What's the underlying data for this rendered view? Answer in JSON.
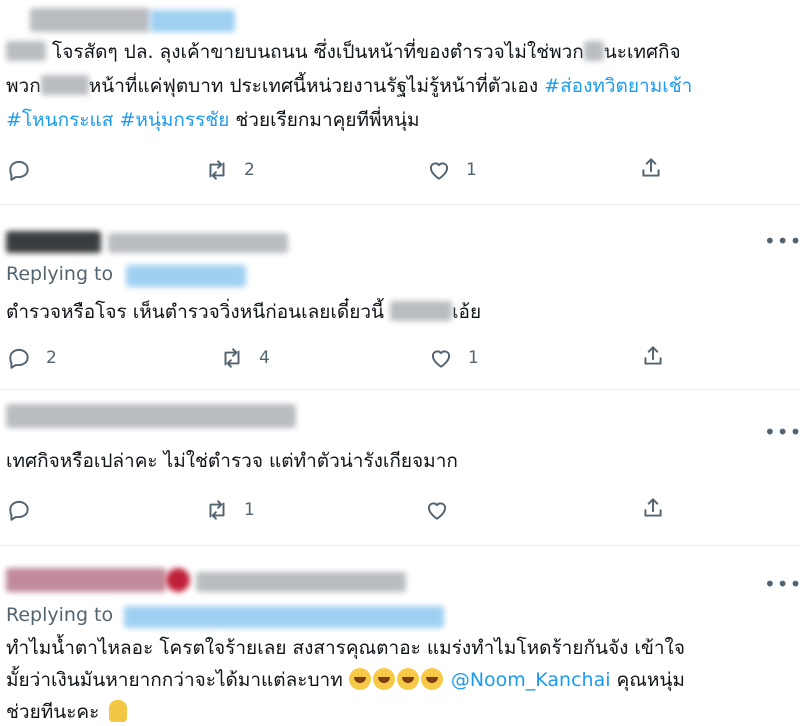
{
  "tweets": [
    {
      "body_lines": [
        {
          "parts": [
            {
              "t": "โจรสัดๆ ปล. ลุงเค้าขายบนถนน ซึ่งเป็นหน้าที่ของตำรวจไม่ใช่พวก",
              "h": false
            },
            {
              "t": "นะเทศกิจ",
              "h": false
            }
          ]
        },
        {
          "parts": [
            {
              "t": "พวก",
              "h": false
            },
            {
              "t": "หน้าที่แค่ฟุตบาท ประเทศนี้หน่วยงานรัฐไม่รู้หน้าที่ตัวเอง ",
              "h": false
            },
            {
              "t": "#ส่องทวิตยามเช้า",
              "h": true
            }
          ]
        },
        {
          "parts": [
            {
              "t": "#โหนกระแส",
              "h": true
            },
            {
              "t": " ",
              "h": false
            },
            {
              "t": "#หนุ่มกรรชัย",
              "h": true
            },
            {
              "t": " ช่วยเรียกมาคุยทีพี่หนุ่ม",
              "h": false
            }
          ]
        }
      ],
      "actions": {
        "reply": "",
        "retweet": "2",
        "like": "1"
      }
    },
    {
      "replying_to": "Replying to",
      "body_lines": [
        {
          "parts": [
            {
              "t": "ตำรวจหรือโจร เห็นตำรวจวิ่งหนีก่อนเลยเดี๋ยวนี้ ",
              "h": false
            },
            {
              "t": "เอ้ย",
              "h": false
            }
          ]
        }
      ],
      "actions": {
        "reply": "2",
        "retweet": "4",
        "like": "1"
      }
    },
    {
      "body_lines": [
        {
          "parts": [
            {
              "t": "เทศกิจหรือเปล่าคะ ไม่ใช่ตำรวจ แต่ทำตัวน่ารังเกียจมาก",
              "h": false
            }
          ]
        }
      ],
      "actions": {
        "reply": "",
        "retweet": "1",
        "like": ""
      }
    },
    {
      "replying_to": "Replying to",
      "line1": "ทำไมน้ำตาไหลอะ โครตใจร้ายเลย สงสารคุณตาอะ แมร่งทำไมโหดร้ายกันจัง เข้าใจ",
      "line2_a": "มั้ยว่าเงินมันหายากกว่าจะได้มาแต่ละบาท ",
      "mention": "@Noom_Kanchai",
      "line2_b": " คุณหนุ่ม",
      "line3": "ช่วยทีนะคะ "
    }
  ],
  "icons": [
    "reply-icon",
    "retweet-icon",
    "like-icon",
    "share-icon",
    "more-icon",
    "crying-emoji-icon",
    "folded-hands-icon"
  ],
  "colors": {
    "hashtag": "#1d9bf0",
    "secondary": "#536471",
    "divider": "#e6ecf0"
  }
}
